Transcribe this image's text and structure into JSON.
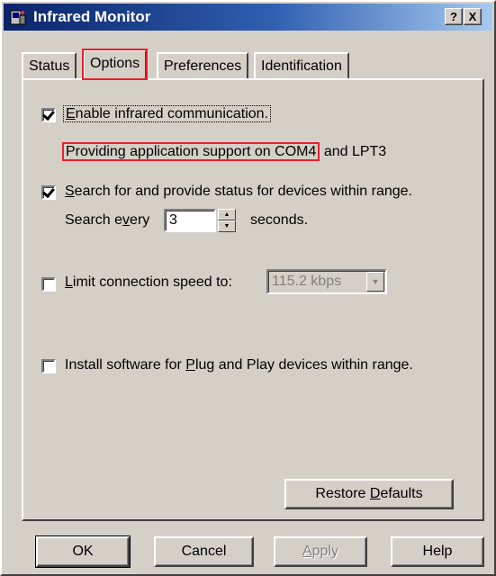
{
  "window": {
    "title": "Infrared Monitor",
    "help_button": "?",
    "close_button": "X"
  },
  "tabs": [
    {
      "label": "Status"
    },
    {
      "label": "Options"
    },
    {
      "label": "Preferences"
    },
    {
      "label": "Identification"
    }
  ],
  "options": {
    "enable_ir": {
      "prefix": "",
      "accel": "E",
      "rest": "nable infrared communication.",
      "checked": true
    },
    "support_text": {
      "highlighted": "Providing application support on COM4",
      "rest": " and LPT3"
    },
    "search": {
      "prefix": "",
      "accel": "S",
      "rest": "earch for and provide status for devices within range.",
      "checked": true
    },
    "search_every": {
      "prefix": "Search e",
      "accel": "v",
      "rest": "ery",
      "value": "3",
      "suffix": "seconds."
    },
    "limit_speed": {
      "prefix": "",
      "accel": "L",
      "rest": "imit connection speed to:",
      "checked": false,
      "selected_value": "115.2 kbps"
    },
    "install_pnp": {
      "prefix": "Install software for ",
      "accel": "P",
      "rest": "lug and Play devices within range.",
      "checked": false
    }
  },
  "buttons": {
    "restore_defaults": {
      "prefix": "Restore ",
      "accel": "D",
      "rest": "efaults"
    },
    "ok": "OK",
    "cancel": "Cancel",
    "apply": {
      "prefix": "",
      "accel": "A",
      "rest": "pply"
    },
    "help": "Help"
  }
}
